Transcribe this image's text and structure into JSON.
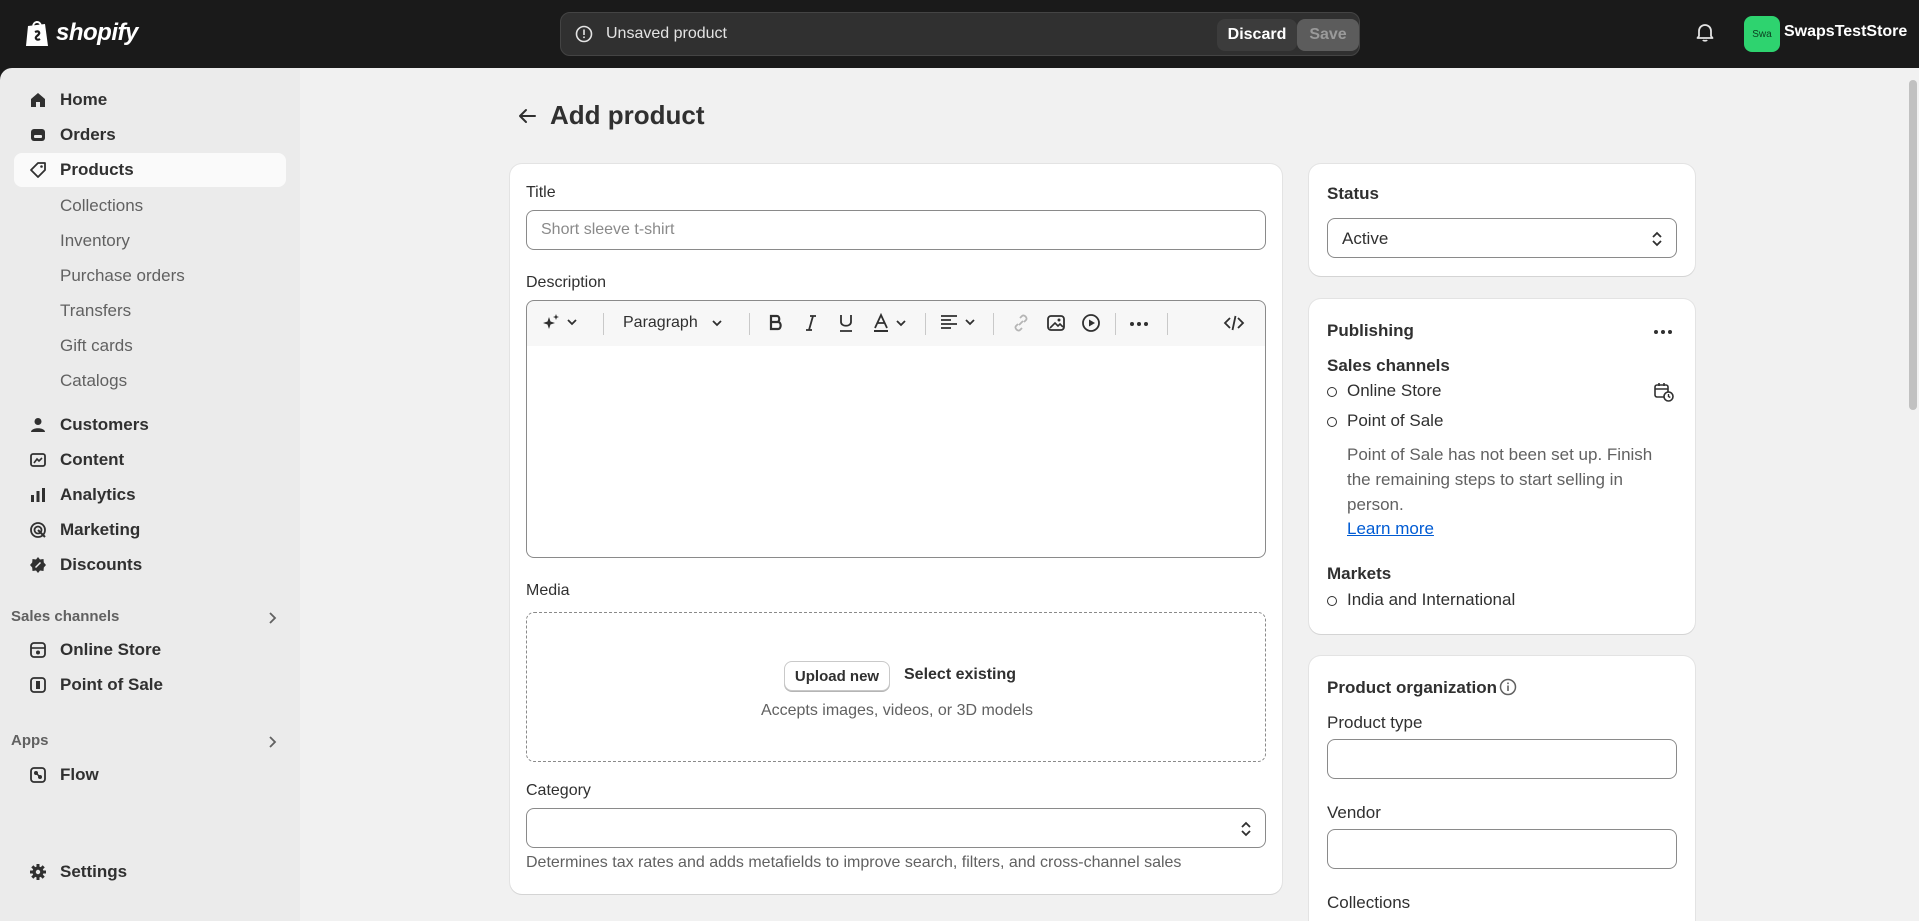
{
  "brand": {
    "logo_text": "shopify"
  },
  "savebar": {
    "message": "Unsaved product",
    "discard_label": "Discard",
    "save_label": "Save"
  },
  "account": {
    "avatar_initials": "Swa",
    "store_name": "SwapsTestStore"
  },
  "sidebar": {
    "main_items": [
      {
        "label": "Home",
        "icon": "home-icon"
      },
      {
        "label": "Orders",
        "icon": "orders-icon"
      },
      {
        "label": "Products",
        "icon": "tag-icon",
        "active": true
      }
    ],
    "product_subitems": [
      "Collections",
      "Inventory",
      "Purchase orders",
      "Transfers",
      "Gift cards",
      "Catalogs"
    ],
    "more_items": [
      {
        "label": "Customers",
        "icon": "person-icon"
      },
      {
        "label": "Content",
        "icon": "content-icon"
      },
      {
        "label": "Analytics",
        "icon": "analytics-icon"
      },
      {
        "label": "Marketing",
        "icon": "marketing-icon"
      },
      {
        "label": "Discounts",
        "icon": "discount-icon"
      }
    ],
    "sales_channels_label": "Sales channels",
    "sales_channels": [
      {
        "label": "Online Store",
        "icon": "store-icon"
      },
      {
        "label": "Point of Sale",
        "icon": "pos-icon"
      }
    ],
    "apps_label": "Apps",
    "apps": [
      {
        "label": "Flow",
        "icon": "flow-icon"
      }
    ],
    "settings_label": "Settings"
  },
  "page": {
    "title": "Add product"
  },
  "form": {
    "title_label": "Title",
    "title_placeholder": "Short sleeve t-shirt",
    "description_label": "Description",
    "toolbar": {
      "paragraph_label": "Paragraph"
    },
    "media_label": "Media",
    "upload_label": "Upload new",
    "select_existing_label": "Select existing",
    "media_hint": "Accepts images, videos, or 3D models",
    "category_label": "Category",
    "category_value": "",
    "category_help": "Determines tax rates and adds metafields to improve search, filters, and cross-channel sales"
  },
  "status": {
    "heading": "Status",
    "value": "Active"
  },
  "publishing": {
    "heading": "Publishing",
    "sales_channels_label": "Sales channels",
    "channels": [
      "Online Store",
      "Point of Sale"
    ],
    "pos_note": "Point of Sale has not been set up. Finish the remaining steps to start selling in person.",
    "learn_more": "Learn more",
    "markets_label": "Markets",
    "markets": [
      "India and International"
    ]
  },
  "organization": {
    "heading": "Product organization",
    "product_type_label": "Product type",
    "vendor_label": "Vendor",
    "collections_label": "Collections"
  },
  "colors": {
    "topbar": "#1a1a1a",
    "sidebar": "#ebebeb",
    "main": "#f1f1f1",
    "link": "#005bd3",
    "avatar": "#2ed36f"
  }
}
